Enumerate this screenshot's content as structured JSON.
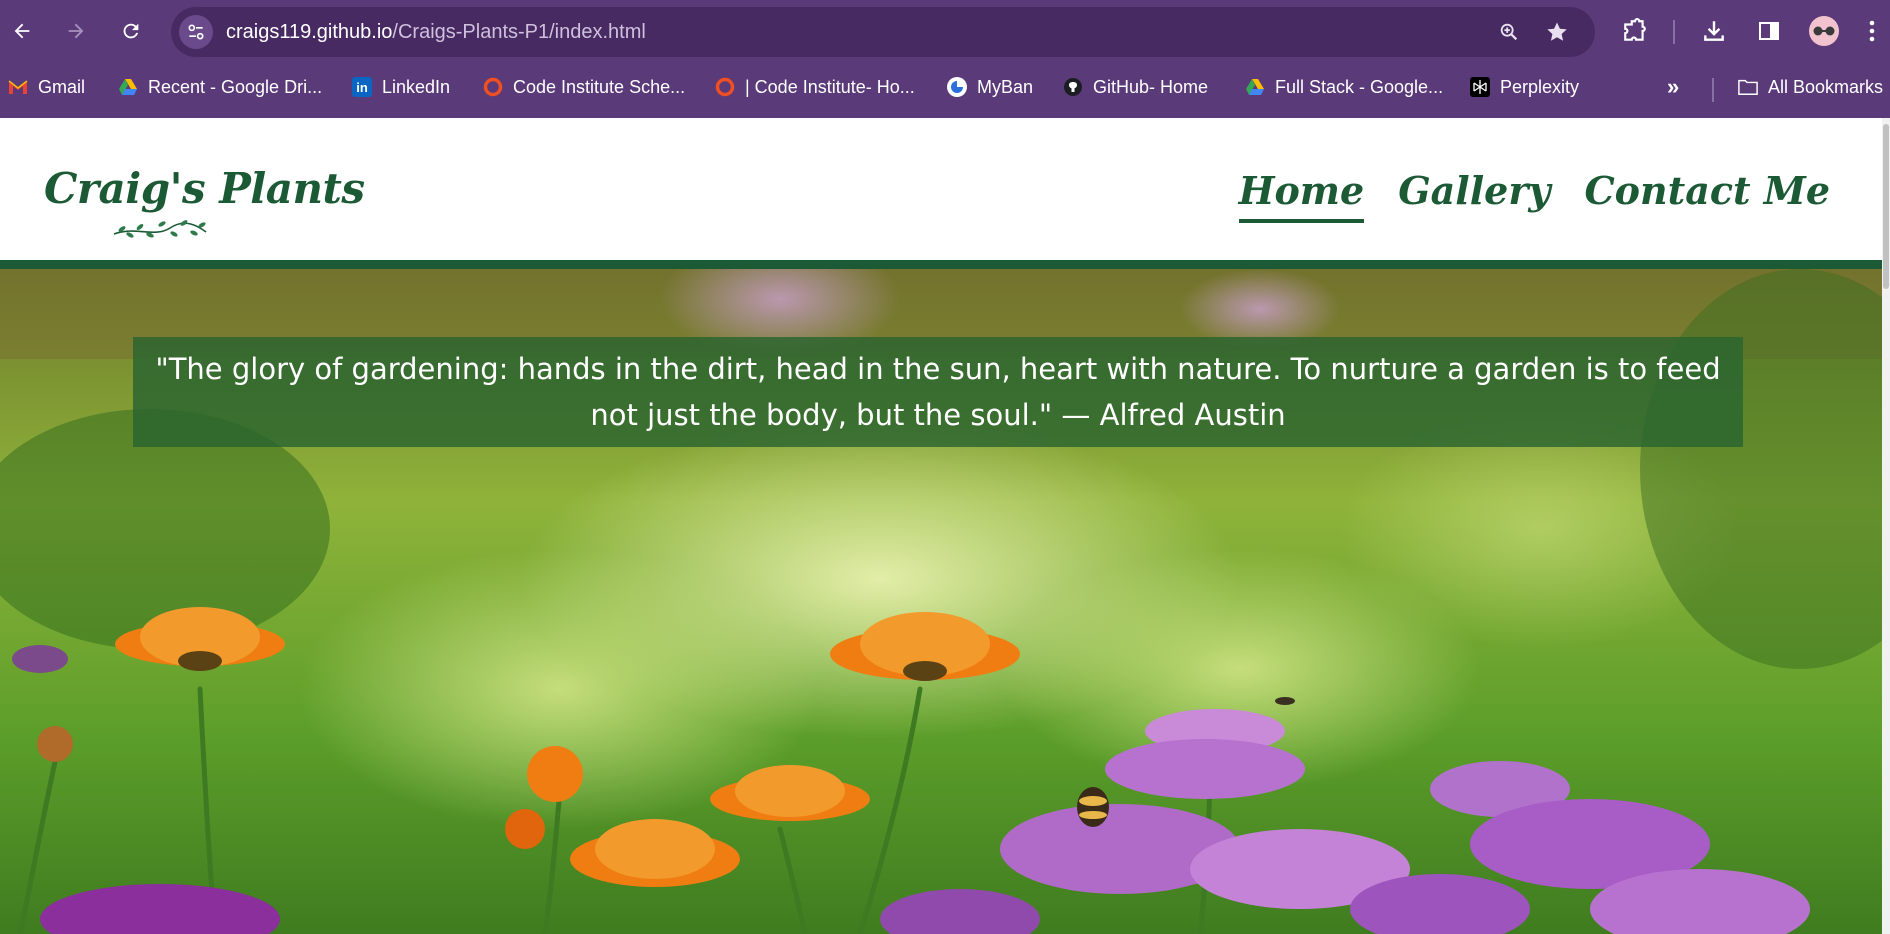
{
  "browser": {
    "url_host": "craigs119.github.io",
    "url_path": "/Craigs-Plants-P1/index.html",
    "bookmarks": [
      {
        "label": "Gmail",
        "icon": "gmail-icon"
      },
      {
        "label": "Recent - Google Dri...",
        "icon": "google-drive-icon"
      },
      {
        "label": "LinkedIn",
        "icon": "linkedin-icon"
      },
      {
        "label": "Code Institute Sche...",
        "icon": "code-institute-icon"
      },
      {
        "label": "| Code Institute- Ho...",
        "icon": "code-institute-icon"
      },
      {
        "label": "MyBan",
        "icon": "myban-icon"
      },
      {
        "label": "GitHub- Home",
        "icon": "github-icon"
      },
      {
        "label": "Full Stack - Google...",
        "icon": "google-drive-icon"
      },
      {
        "label": "Perplexity",
        "icon": "perplexity-icon"
      }
    ],
    "all_bookmarks": "All Bookmarks",
    "theme_color": "#5b3a7a"
  },
  "site": {
    "logo": "Craig's Plants",
    "nav": [
      "Home",
      "Gallery",
      "Contact Me"
    ],
    "active_nav": "Home",
    "brand_color": "#1c5a36"
  },
  "hero": {
    "quote": "\"The glory of gardening: hands in the dirt, head in the sun, heart with nature. To nurture a garden is to feed not just the body, but the soul.\" — Alfred Austin"
  }
}
